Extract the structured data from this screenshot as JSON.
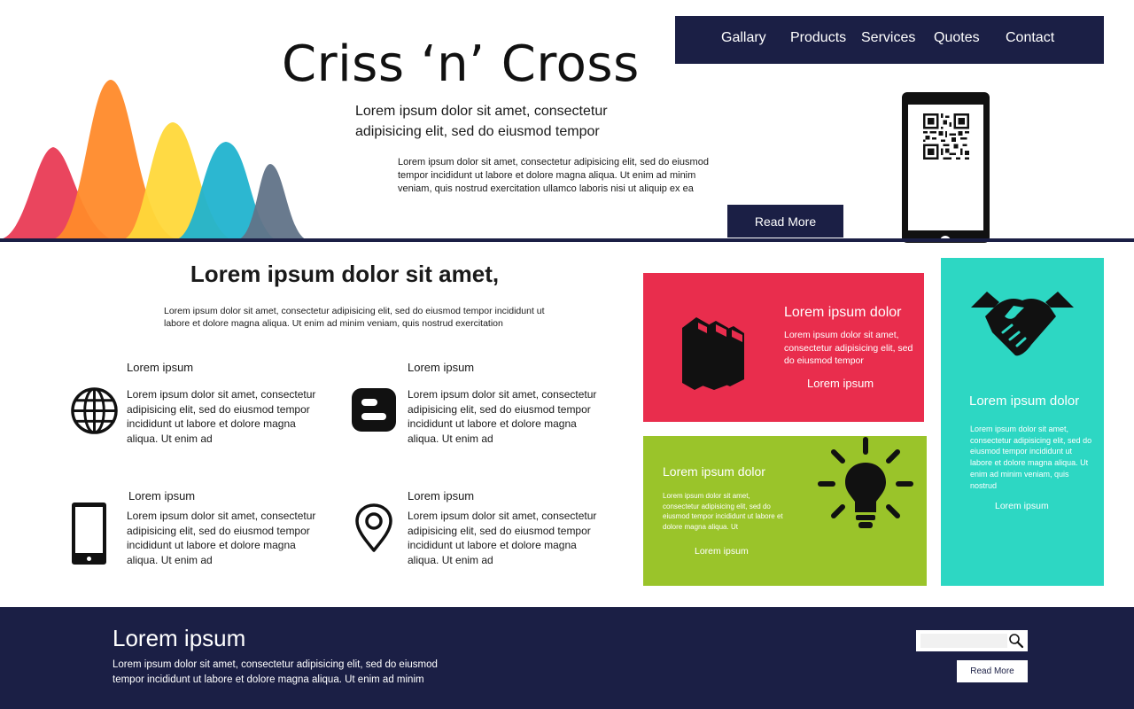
{
  "header": {
    "title": "Criss ‘n’ Cross",
    "tagline": "Lorem ipsum dolor sit amet, consectetur adipisicing elit, sed do eiusmod tempor",
    "description": "Lorem ipsum dolor sit amet, consectetur adipisicing elit, sed do eiusmod tempor incididunt ut labore et dolore magna aliqua. Ut enim ad minim veniam, quis nostrud exercitation ullamco laboris nisi ut aliquip ex ea",
    "read_more": "Read More"
  },
  "nav": {
    "items": [
      {
        "label": "Gallary"
      },
      {
        "label": "Products"
      },
      {
        "label": "Services"
      },
      {
        "label": "Quotes"
      },
      {
        "label": "Contact"
      }
    ]
  },
  "section": {
    "heading": "Lorem ipsum dolor sit amet,",
    "description": "Lorem ipsum dolor sit amet, consectetur adipisicing elit, sed do eiusmod tempor incididunt ut labore et dolore magna aliqua. Ut enim ad minim veniam, quis nostrud exercitation"
  },
  "features": [
    {
      "title": "Lorem ipsum",
      "icon": "globe-icon",
      "text": "Lorem ipsum dolor sit amet, consectetur adipisicing elit, sed do eiusmod tempor incididunt ut labore et dolore magna aliqua. Ut enim ad"
    },
    {
      "title": "Lorem ipsum",
      "icon": "blogger-icon",
      "text": "Lorem ipsum dolor sit amet, consectetur adipisicing elit, sed do eiusmod tempor incididunt ut labore et dolore magna aliqua. Ut enim ad"
    },
    {
      "title": "Lorem ipsum",
      "icon": "mobile-phone-icon",
      "text": "Lorem ipsum dolor sit amet, consectetur adipisicing elit, sed do eiusmod tempor incididunt ut labore et dolore magna aliqua. Ut enim ad"
    },
    {
      "title": "Lorem ipsum",
      "icon": "location-pin-icon",
      "text": "Lorem ipsum dolor sit amet, consectetur adipisicing elit, sed do eiusmod tempor incididunt ut labore et dolore magna aliqua. Ut enim ad"
    }
  ],
  "tiles": {
    "red": {
      "heading": "Lorem ipsum dolor",
      "text": "Lorem ipsum dolor sit amet, consectetur adipisicing elit, sed do eiusmod tempor",
      "link": "Lorem ipsum",
      "icon": "books-icon",
      "color": "#e92d4d"
    },
    "green": {
      "heading": "Lorem ipsum dolor",
      "text": "Lorem ipsum dolor sit amet, consectetur adipisicing elit, sed do eiusmod tempor incididunt ut labore et dolore magna aliqua. Ut",
      "link": "Lorem ipsum",
      "icon": "lightbulb-icon",
      "color": "#9ac42a"
    },
    "teal": {
      "heading": "Lorem ipsum dolor",
      "text": "Lorem ipsum dolor sit amet, consectetur adipisicing elit, sed do eiusmod tempor incididunt ut labore et dolore magna aliqua. Ut enim ad minim veniam, quis nostrud",
      "link": "Lorem ipsum",
      "icon": "handshake-icon",
      "color": "#2dd7c3"
    }
  },
  "footer": {
    "title": "Lorem ipsum",
    "text": "Lorem ipsum dolor sit amet, consectetur adipisicing elit, sed do eiusmod tempor incididunt ut labore et dolore magna aliqua. Ut enim ad minim",
    "search_placeholder": "",
    "read_more": "Read More"
  },
  "colors": {
    "navy": "#1b1f45",
    "red": "#e92d4d",
    "orange": "#ff8a2a",
    "yellow": "#ffd83a",
    "blue": "#21b3cf",
    "slate": "#617388",
    "green": "#9ac42a",
    "teal": "#2dd7c3"
  }
}
